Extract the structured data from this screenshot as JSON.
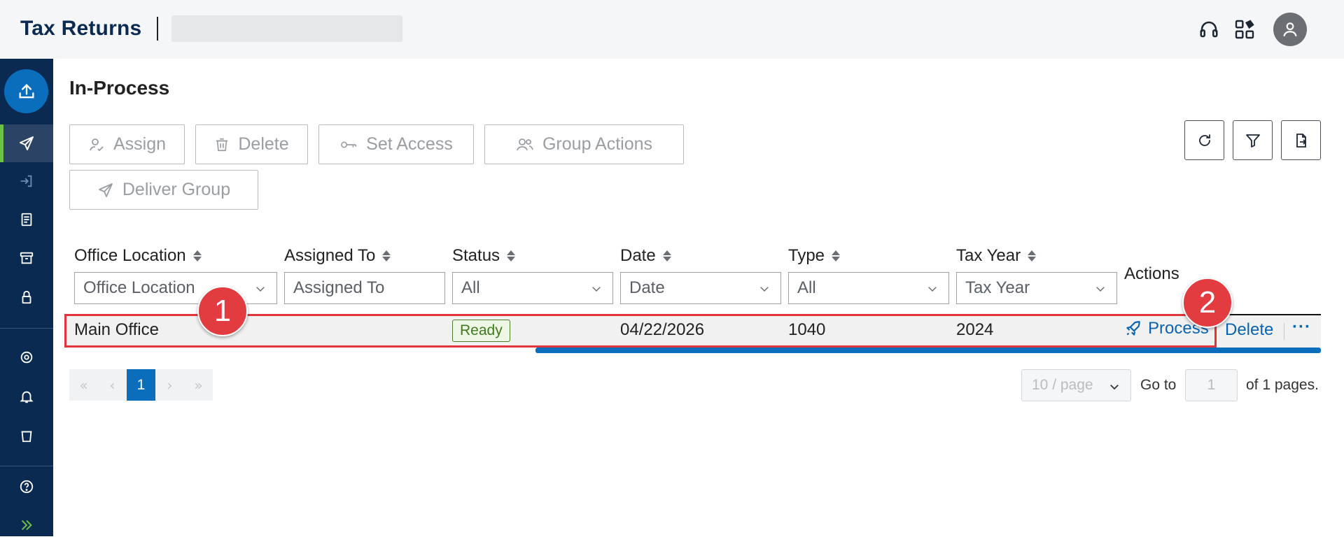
{
  "header": {
    "title": "Tax Returns"
  },
  "icons": {
    "headset": "headset-icon",
    "apps": "apps-icon",
    "user": "user-icon"
  },
  "page": {
    "title": "In-Process"
  },
  "toolbar": {
    "assign": "Assign",
    "delete": "Delete",
    "set_access": "Set Access",
    "group_actions": "Group Actions",
    "deliver_group": "Deliver Group"
  },
  "table": {
    "columns": [
      "Office Location",
      "Assigned To",
      "Status",
      "Date",
      "Type",
      "Tax Year"
    ],
    "actions_header": "Actions",
    "filters": {
      "office_location": "Office Location",
      "assigned_to": "Assigned To",
      "status": "All",
      "date": "Date",
      "type": "All",
      "tax_year": "Tax Year"
    },
    "rows": [
      {
        "office_location": "Main Office",
        "assigned_to": "",
        "status": "Ready",
        "date": "04/22/2026",
        "type": "1040",
        "tax_year": "2024",
        "action_process": "Process",
        "action_delete": "Delete",
        "action_more": "···"
      }
    ]
  },
  "callouts": [
    "1",
    "2"
  ],
  "pagination": {
    "current_page": "1",
    "per_page": "10 / page",
    "goto_label": "Go to",
    "goto_value": "1",
    "pages_label": "of 1 pages."
  },
  "colors": {
    "brand_navy": "#0b2a52",
    "accent_blue": "#0a6ebd",
    "active_green": "#6cc04a",
    "callout_red": "#e23b40"
  }
}
